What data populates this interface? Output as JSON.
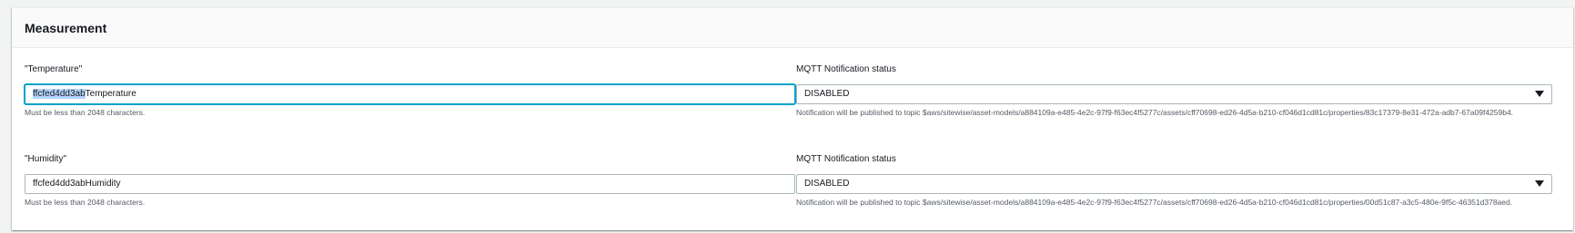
{
  "section": {
    "title": "Measurement"
  },
  "measurements": [
    {
      "label": "\"Temperature\"",
      "value_selected": "ffcfed4dd3ab",
      "value_rest": "Temperature",
      "hint": "Must be less than 2048 characters.",
      "mqtt_label": "MQTT Notification status",
      "mqtt_status": "DISABLED",
      "mqtt_hint": "Notification will be published to topic $aws/sitewise/asset-models/a884109a-e485-4e2c-97f9-f63ec4f5277c/assets/cff70698-ed26-4d5a-b210-cf046d1cd81c/properties/83c17379-8e31-472a-adb7-67a09f4259b4."
    },
    {
      "label": "\"Humidity\"",
      "value": "ffcfed4dd3abHumidity",
      "hint": "Must be less than 2048 characters.",
      "mqtt_label": "MQTT Notification status",
      "mqtt_status": "DISABLED",
      "mqtt_hint": "Notification will be published to topic $aws/sitewise/asset-models/a884109a-e485-4e2c-97f9-f63ec4f5277c/assets/cff70698-ed26-4d5a-b210-cf046d1cd81c/properties/00d51c87-a3c5-480e-9f5c-46351d378aed."
    }
  ],
  "icons": {
    "select_caret": "caret-down-icon"
  },
  "colors": {
    "focus_border": "#00a1c9",
    "selection_highlight": "#b4d5fe",
    "input_border": "#aab7b8"
  }
}
